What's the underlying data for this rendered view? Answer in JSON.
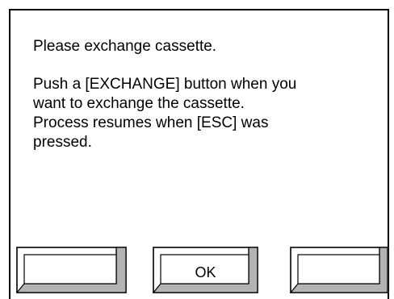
{
  "dialog": {
    "line1": "Please exchange cassette.",
    "line2": "Push a [EXCHANGE] button when you\nwant to exchange the cassette.\nProcess resumes when [ESC] was\npressed."
  },
  "buttons": {
    "left_label": "",
    "ok_label": "OK",
    "right_label": ""
  }
}
